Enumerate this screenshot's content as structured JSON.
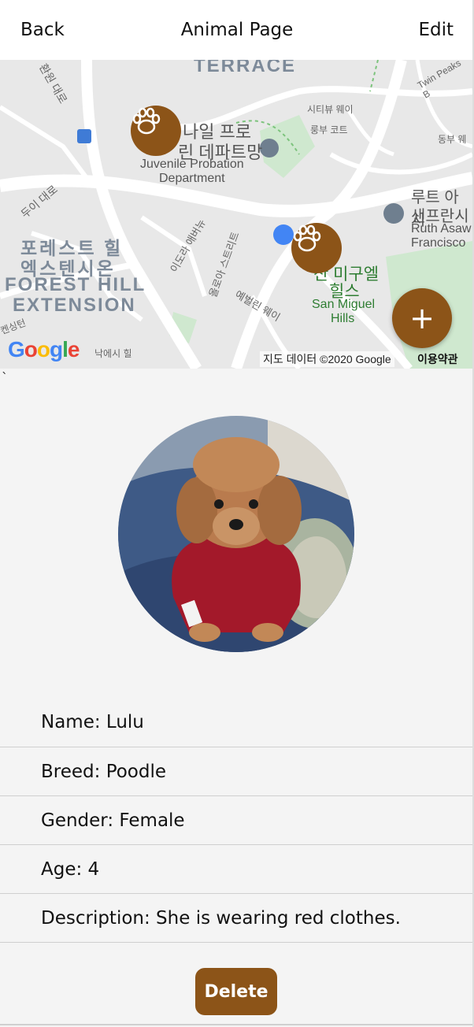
{
  "header": {
    "back_label": "Back",
    "title": "Animal Page",
    "edit_label": "Edit"
  },
  "map": {
    "labels": {
      "terrace": "TERRACE",
      "nailang": "나일 프로",
      "department_kr": "린 데파트망",
      "juvenile": "Juvenile Probation",
      "department": "Department",
      "forest_kr1": "포레스트 힐",
      "forest_kr2": "엑스텐시온",
      "forest_en1": "FOREST HILL",
      "forest_en2": "EXTENSION",
      "ruth_kr1": "루트 아시",
      "ruth_kr2": "샌프란시",
      "ruth_en1": "Ruth Asaw",
      "ruth_en2": "Francisco",
      "sanmiguel_kr1": "산 미구엘",
      "sanmiguel_kr2": "힐스",
      "sanmiguel_en1": "San Miguel",
      "sanmiguel_en2": "Hills",
      "cityview": "시티뷰 웨이",
      "rungbu": "룽부 코트",
      "dubai": "두이 대로",
      "hwanwon": "환원 대로",
      "idoraebanu": "이도라 애버뉴",
      "olaa": "올로아 스트리트",
      "yebeolrin": "예벌린 웨이",
      "nakeshi": "낙에시 힐",
      "kensington": "켄싱턴",
      "dongbu": "동부 웨",
      "junpeaks": "Twin Peaks B"
    },
    "google_logo": "Google",
    "map_data_credit": "지도 데이터 ©2020 Google",
    "terms": "이용약관",
    "fab_label": "+",
    "colors": {
      "marker": "#8c5418",
      "road": "#ffffff",
      "park": "#c8e6c9"
    }
  },
  "stray_mark": "`",
  "animal": {
    "name": "Name: Lulu",
    "breed": "Breed: Poodle",
    "gender": "Gender: Female",
    "age": "Age: 4",
    "description": "Description: She is wearing red clothes."
  },
  "actions": {
    "delete_label": "Delete"
  }
}
